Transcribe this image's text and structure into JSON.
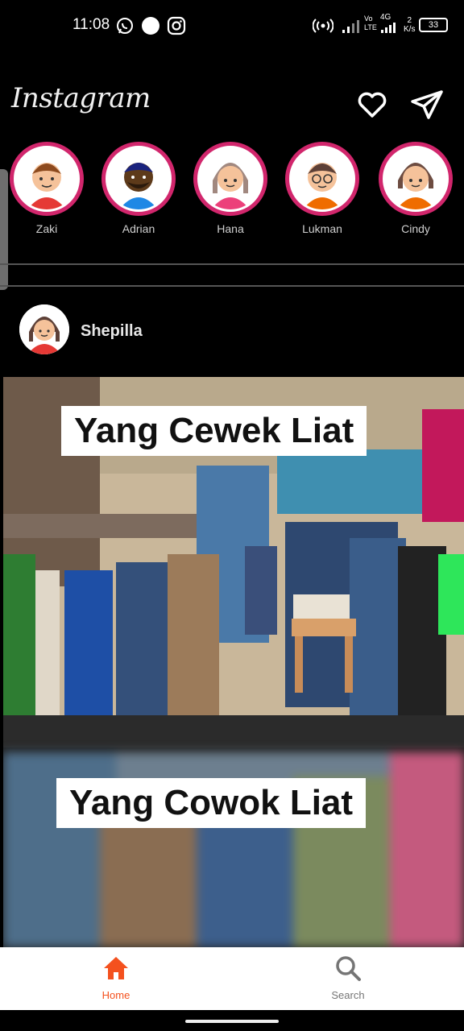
{
  "status_bar": {
    "time": "11:08",
    "network_label_top": "Vo",
    "network_label_bottom": "LTE",
    "net_gen": "4G",
    "speed_top": "2",
    "speed_bottom": "K/s",
    "battery": "33"
  },
  "header": {
    "brand": "Instagram",
    "icons": [
      "heart-icon",
      "send-icon"
    ]
  },
  "stories": [
    {
      "name": "Zaki"
    },
    {
      "name": "Adrian"
    },
    {
      "name": "Hana"
    },
    {
      "name": "Lukman"
    },
    {
      "name": "Cindy"
    }
  ],
  "post": {
    "username": "Shepilla",
    "caption_top": "Yang Cewek Liat",
    "caption_bottom": "Yang Cowok Liat"
  },
  "bottom_nav": {
    "items": [
      {
        "label": "Home",
        "icon": "home-icon",
        "active": true
      },
      {
        "label": "Search",
        "icon": "search-icon",
        "active": false
      }
    ],
    "active_color": "#f4511e",
    "inactive_color": "#757575"
  },
  "colors": {
    "story_ring": "#d1266c",
    "background": "#000000"
  }
}
